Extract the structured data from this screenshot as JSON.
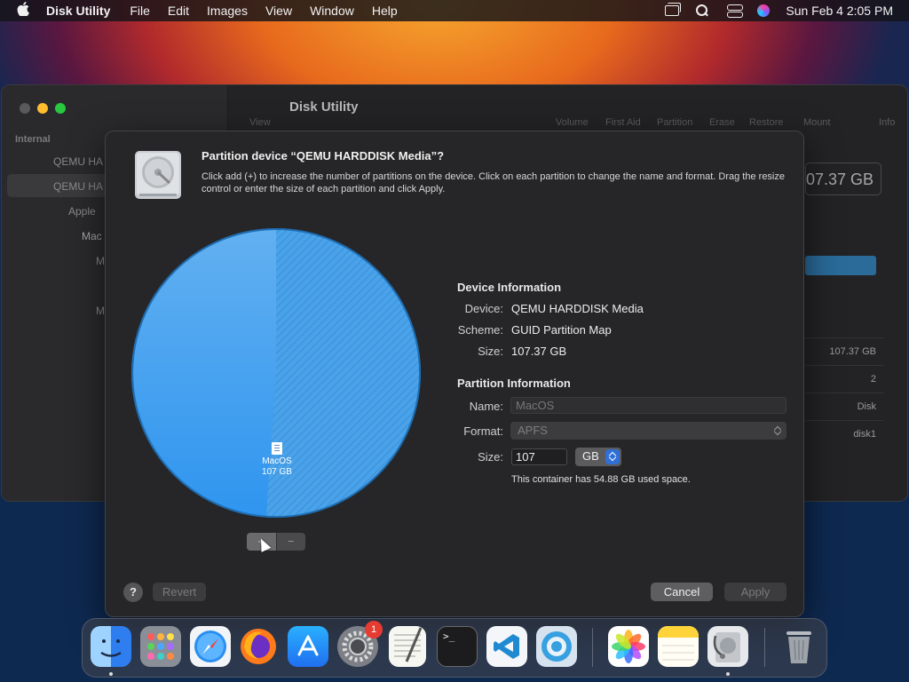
{
  "menubar": {
    "app_name": "Disk Utility",
    "menus": [
      "File",
      "Edit",
      "Images",
      "View",
      "Window",
      "Help"
    ],
    "clock": "Sun Feb 4  2:05 PM",
    "icons": [
      "apple-icon",
      "window-switch-icon",
      "search-icon",
      "control-center-icon",
      "siri-icon"
    ]
  },
  "background_window": {
    "title": "Disk Utility",
    "sidebar_section": "Internal",
    "sidebar_rows": [
      "QEMU HA",
      "QEMU HA",
      "Apple",
      "Mac",
      "M",
      "M"
    ],
    "toolbar_labels": [
      "View",
      "Volume",
      "First Aid",
      "Partition",
      "Erase",
      "Restore",
      "Mount",
      "Info"
    ],
    "capacity": "07.37 GB",
    "cells": [
      "107.37 GB",
      "2",
      "Disk",
      "disk1"
    ]
  },
  "sheet": {
    "title": "Partition device “QEMU HARDDISK Media”?",
    "description": "Click add (+) to increase the number of partitions on the device. Click on each partition to change the name and format. Drag the resize control or enter the size of each partition and click Apply.",
    "pie_partition": {
      "name": "MacOS",
      "size": "107 GB",
      "color": "#3a9ff0",
      "used_fraction": 0.511
    },
    "device_info": {
      "heading": "Device Information",
      "device_label": "Device:",
      "device_value": "QEMU HARDDISK Media",
      "scheme_label": "Scheme:",
      "scheme_value": "GUID Partition Map",
      "size_label": "Size:",
      "size_value": "107.37 GB"
    },
    "partition_info": {
      "heading": "Partition Information",
      "name_label": "Name:",
      "name_placeholder": "MacOS",
      "format_label": "Format:",
      "format_value": "APFS",
      "size_label": "Size:",
      "size_value": "107",
      "size_unit": "GB",
      "note": "This container has 54.88 GB used space."
    },
    "add_label": "+",
    "remove_label": "−",
    "help_label": "?",
    "revert_label": "Revert",
    "cancel_label": "Cancel",
    "apply_label": "Apply"
  },
  "dock": {
    "badge_count": "1",
    "items": [
      "finder-icon",
      "launchpad-icon",
      "safari-icon",
      "firefox-icon",
      "app-store-icon",
      "system-preferences-icon",
      "textedit-icon",
      "terminal-icon",
      "vscode-icon",
      "disk-image-icon",
      "photos-icon",
      "notes-icon",
      "disk-utility-icon",
      "trash-icon"
    ],
    "terminal_prompt": ">_"
  }
}
